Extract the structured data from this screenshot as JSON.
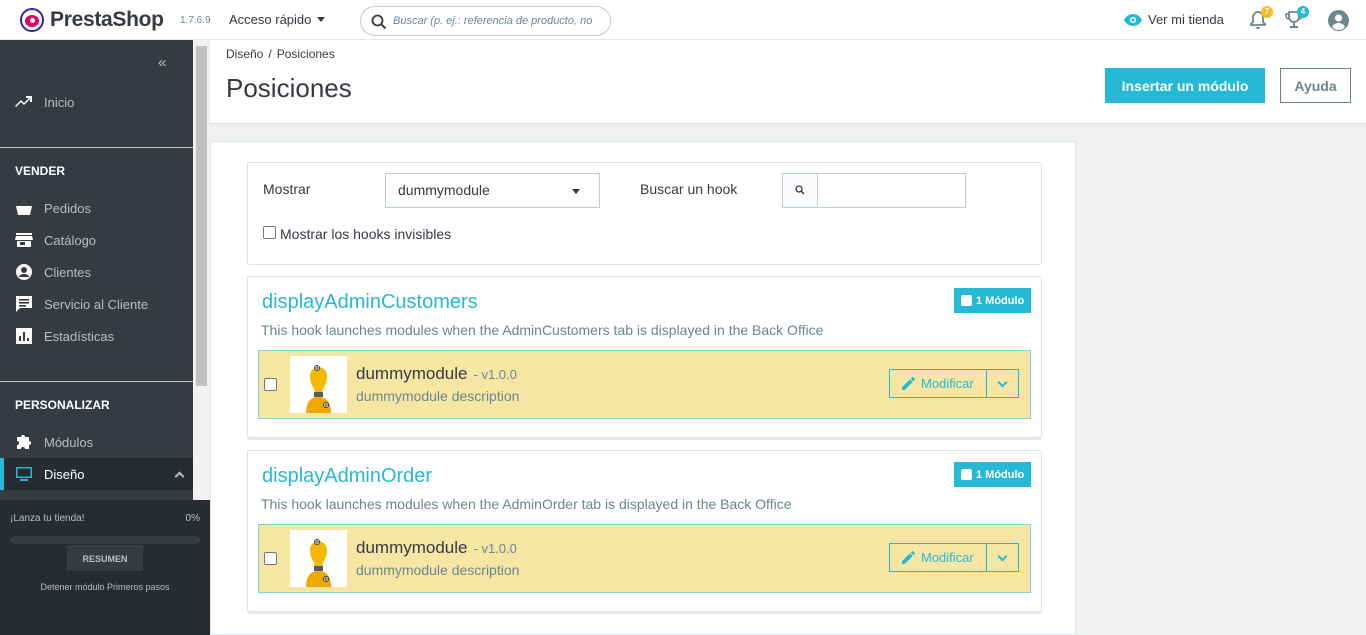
{
  "header": {
    "brand": "PrestaShop",
    "version": "1.7.6.9",
    "quick_access": "Acceso rápido",
    "search_placeholder": "Buscar (p. ej.: referencia de producto, no",
    "view_store": "Ver mi tienda",
    "notifications_count": "7",
    "trophy_count": "4"
  },
  "sidebar": {
    "inicio": "Inicio",
    "sell_heading": "VENDER",
    "sell_items": [
      "Pedidos",
      "Catálogo",
      "Clientes",
      "Servicio al Cliente",
      "Estadísticas"
    ],
    "customize_heading": "PERSONALIZAR",
    "modules": "Módulos",
    "design": "Diseño"
  },
  "onboarding": {
    "title": "¡Lanza tu tienda!",
    "percent": "0%",
    "progress": 0,
    "button": "RESUMEN",
    "stop": "Detener módulo Primeros pasos"
  },
  "page": {
    "breadcrumb_parent": "Diseño",
    "breadcrumb_current": "Posiciones",
    "title": "Posiciones",
    "insert_button": "Insertar un módulo",
    "help_button": "Ayuda"
  },
  "filter": {
    "show_label": "Mostrar",
    "show_value": "dummymodule",
    "search_label": "Buscar un hook",
    "invisible_label": "Mostrar los hooks invisibles"
  },
  "hooks": [
    {
      "name": "displayAdminCustomers",
      "description": "This hook launches modules when the AdminCustomers tab is displayed in the Back Office",
      "badge": "1 Módulo",
      "module_name": "dummymodule",
      "module_version": "- v1.0.0",
      "module_desc": "dummymodule description",
      "edit_label": "Modificar"
    },
    {
      "name": "displayAdminOrder",
      "description": "This hook launches modules when the AdminOrder tab is displayed in the Back Office",
      "badge": "1 Módulo",
      "module_name": "dummymodule",
      "module_version": "- v1.0.0",
      "module_desc": "dummymodule description",
      "edit_label": "Modificar"
    }
  ],
  "colors": {
    "accent": "#25b9d7",
    "sidebar": "#363a41",
    "module_row": "#f5e6a3",
    "notif_badge": "#fbbb22",
    "trophy_badge": "#25b9d7"
  },
  "icons": [
    "search-icon",
    "eye-icon",
    "bell-icon",
    "trophy-icon",
    "user-icon",
    "collapse-icon",
    "trend-icon",
    "basket-icon",
    "store-icon",
    "person-icon",
    "chat-icon",
    "chart-icon",
    "puzzle-icon",
    "monitor-icon",
    "pencil-icon",
    "chevron-down-icon"
  ]
}
